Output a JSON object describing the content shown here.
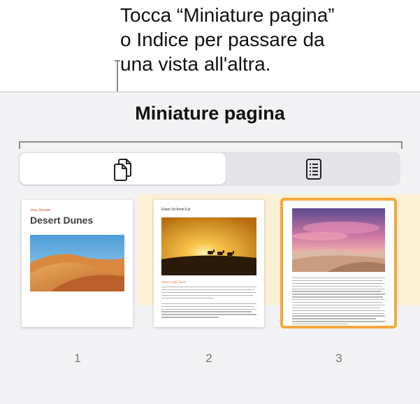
{
  "callout": {
    "line1": "Tocca “Miniature pagina”",
    "line2": "o Indice per passare da",
    "line3": "una vista all'altra."
  },
  "panel": {
    "title": "Miniature pagina"
  },
  "segmented_control": {
    "options": [
      {
        "icon": "page-thumbnails-icon",
        "selected": true
      },
      {
        "icon": "table-of-contents-icon",
        "selected": false
      }
    ]
  },
  "pages": [
    {
      "number": "1",
      "kicker": "Urna Semper",
      "title": "Desert Dunes",
      "image": "desert-dunes-photo"
    },
    {
      "number": "2",
      "title": "Etiam Sit Amet Est",
      "caption": "Donec Quis Nunc",
      "image": "camel-caravan-sunset-photo"
    },
    {
      "number": "3",
      "image": "pink-sky-dunes-photo",
      "selected": true
    }
  ],
  "colors": {
    "selection_highlight": "#fbefd6",
    "selection_border": "#f2a93b",
    "accent_text": "#d9533a"
  }
}
